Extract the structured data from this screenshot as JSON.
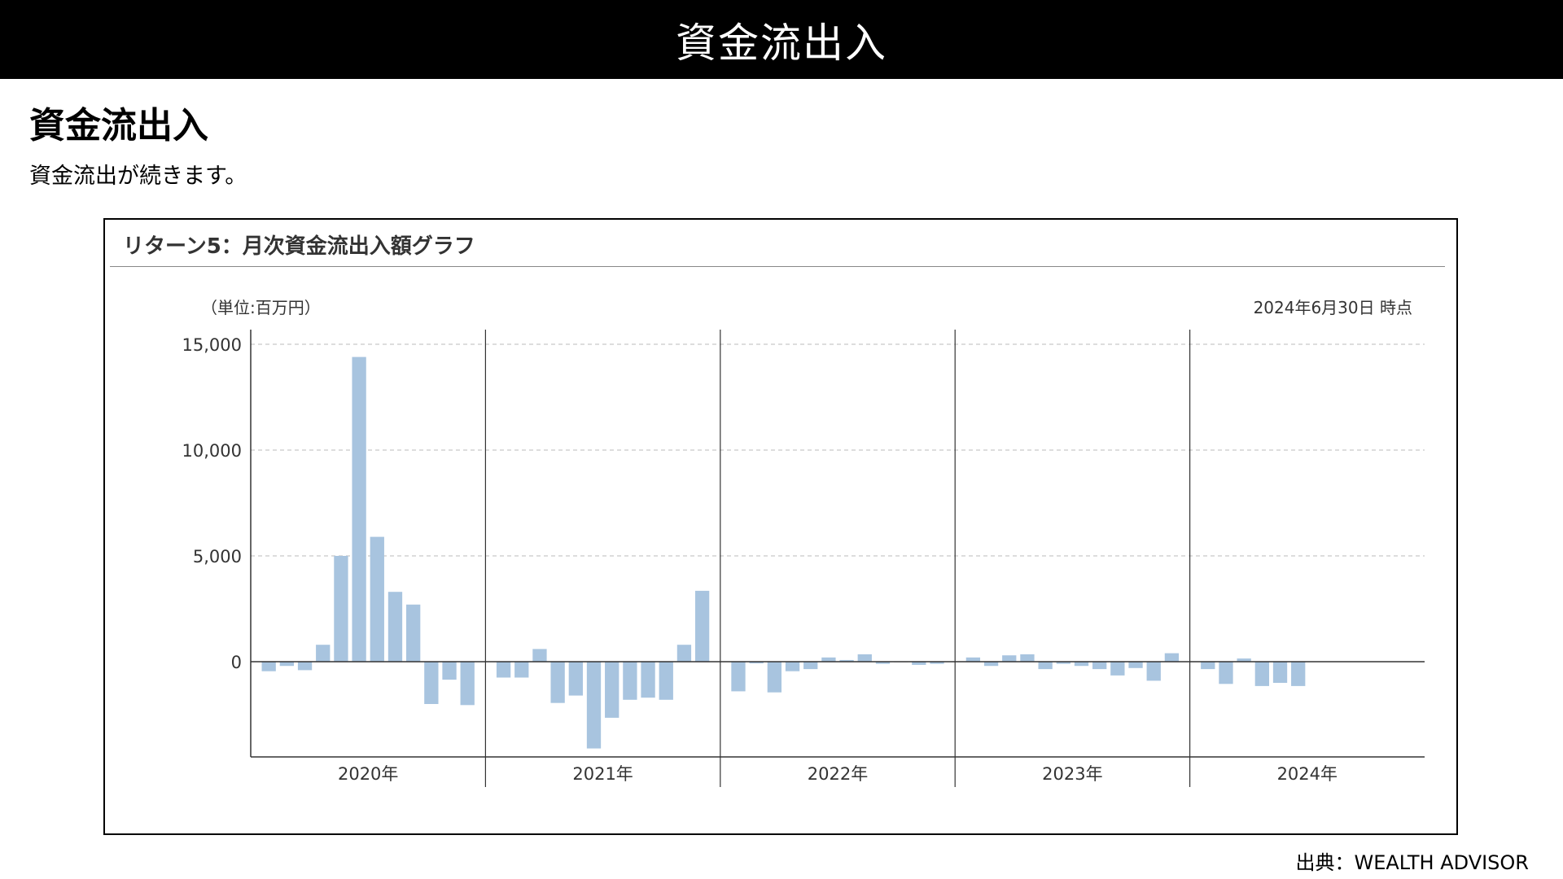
{
  "page": {
    "banner_title": "資金流出入",
    "heading": "資金流出入",
    "lead_text": "資金流出が続きます。",
    "source": "出典：WEALTH ADVISOR"
  },
  "chart_frame": {
    "title": "リターン5：月次資金流出入額グラフ",
    "unit": "（単位:百万円）",
    "as_of": "2024年6月30日 時点"
  },
  "chart_data": {
    "type": "bar",
    "title": "リターン5：月次資金流出入額グラフ",
    "ylabel": "（単位:百万円）",
    "xlabel": "",
    "ylim": [
      -4500,
      15000
    ],
    "yticks": [
      0,
      5000,
      10000,
      15000
    ],
    "ytick_labels": [
      "0",
      "5,000",
      "10,000",
      "15,000"
    ],
    "grid": true,
    "bar_color": "#a8c4df",
    "year_groups": [
      "2020年",
      "2021年",
      "2022年",
      "2023年",
      "2024年"
    ],
    "categories": [
      "2020-01",
      "2020-02",
      "2020-03",
      "2020-04",
      "2020-05",
      "2020-06",
      "2020-07",
      "2020-08",
      "2020-09",
      "2020-10",
      "2020-11",
      "2020-12",
      "2021-01",
      "2021-02",
      "2021-03",
      "2021-04",
      "2021-05",
      "2021-06",
      "2021-07",
      "2021-08",
      "2021-09",
      "2021-10",
      "2021-11",
      "2021-12",
      "2022-01",
      "2022-02",
      "2022-03",
      "2022-04",
      "2022-05",
      "2022-06",
      "2022-07",
      "2022-08",
      "2022-09",
      "2022-10",
      "2022-11",
      "2022-12",
      "2023-01",
      "2023-02",
      "2023-03",
      "2023-04",
      "2023-05",
      "2023-06",
      "2023-07",
      "2023-08",
      "2023-09",
      "2023-10",
      "2023-11",
      "2023-12",
      "2024-01",
      "2024-02",
      "2024-03",
      "2024-04",
      "2024-05",
      "2024-06"
    ],
    "values": [
      -450,
      -200,
      -400,
      800,
      5000,
      14400,
      5900,
      3300,
      2700,
      -2000,
      -850,
      -2050,
      -750,
      -750,
      600,
      -1950,
      -1600,
      -4100,
      -2650,
      -1800,
      -1700,
      -1800,
      800,
      3350,
      -1400,
      -80,
      -1450,
      -450,
      -350,
      200,
      80,
      350,
      -100,
      0,
      -150,
      -100,
      200,
      -200,
      300,
      350,
      -350,
      -100,
      -200,
      -350,
      -650,
      -300,
      -900,
      400,
      -350,
      -1050,
      150,
      -1150,
      -1000,
      -1150
    ]
  }
}
